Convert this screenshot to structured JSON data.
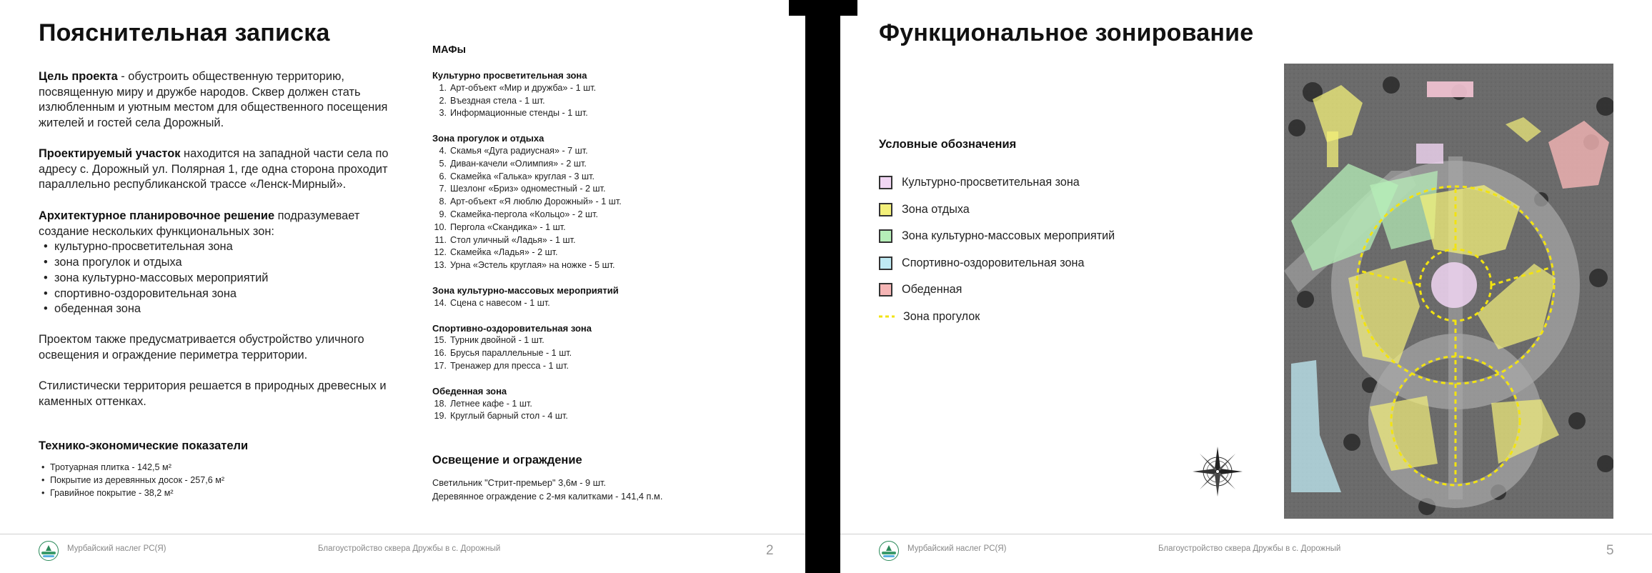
{
  "left_page": {
    "title": "Пояснительная записка",
    "goal": {
      "label": "Цель проекта",
      "text": " - обустроить общественную территорию, посвященную миру и дружбе народов. Сквер должен стать излюбленным и уютным местом для общественного посещения жителей и гостей села Дорожный."
    },
    "site": {
      "label": "Проектируемый участок",
      "text": " находится на западной части села по адресу с. Дорожный ул. Полярная 1, где одна сторона проходит параллельно республиканской трассе «Ленск-Мирный»."
    },
    "arch": {
      "label": "Архитектурное планировочное решение",
      "text": " подразумевает создание нескольких функциональных зон:",
      "zones": [
        "культурно-просветительная зона",
        "зона прогулок и отдыха",
        "зона культурно-массовых мероприятий",
        "спортивно-оздоровительная зона",
        "обеденная зона"
      ]
    },
    "lighting_text": "Проектом также предусматривается обустройство уличного освещения и ограждение периметра территории.",
    "style_text": "Стилистически территория решается в природных древесных и каменных оттенках.",
    "tep": {
      "title": "Технико-экономические показатели",
      "items": [
        "Тротуарная плитка - 142,5 м²",
        "Покрытие из деревянных досок - 257,6 м²",
        "Гравийное покрытие - 38,2 м²"
      ]
    },
    "mafs": {
      "title": "МАФы",
      "groups": [
        {
          "title": "Культурно просветительная зона",
          "items": [
            {
              "n": "1.",
              "t": "Арт-объект «Мир и дружба» - 1 шт."
            },
            {
              "n": "2.",
              "t": "Въездная стела - 1 шт."
            },
            {
              "n": "3.",
              "t": "Информационные стенды - 1 шт."
            }
          ]
        },
        {
          "title": "Зона прогулок и отдыха",
          "items": [
            {
              "n": "4.",
              "t": "Скамья «Дуга радиусная» - 7 шт."
            },
            {
              "n": "5.",
              "t": "Диван-качели «Олимпия» - 2 шт."
            },
            {
              "n": "6.",
              "t": "Скамейка «Галька» круглая - 3 шт."
            },
            {
              "n": "7.",
              "t": "Шезлонг «Бриз» одноместный - 2 шт."
            },
            {
              "n": "8.",
              "t": "Арт-объект «Я люблю Дорожный» - 1 шт."
            },
            {
              "n": "9.",
              "t": "Скамейка-пергола «Кольцо» - 2 шт."
            },
            {
              "n": "10.",
              "t": "Пергола «Скандика» - 1 шт."
            },
            {
              "n": "11.",
              "t": "Стол уличный «Ладья» - 1 шт."
            },
            {
              "n": "12.",
              "t": "Скамейка «Ладья» - 2 шт."
            },
            {
              "n": "13.",
              "t": "Урна «Эстель круглая» на ножке - 5 шт."
            }
          ]
        },
        {
          "title": "Зона культурно-массовых мероприятий",
          "items": [
            {
              "n": "14.",
              "t": "Сцена с навесом - 1 шт."
            }
          ]
        },
        {
          "title": "Спортивно-оздоровительная зона",
          "items": [
            {
              "n": "15.",
              "t": "Турник двойной - 1 шт."
            },
            {
              "n": "16.",
              "t": "Брусья параллельные - 1 шт."
            },
            {
              "n": "17.",
              "t": "Тренажер для пресса - 1 шт."
            }
          ]
        },
        {
          "title": "Обеденная зона",
          "items": [
            {
              "n": "18.",
              "t": "Летнее кафе - 1 шт."
            },
            {
              "n": "19.",
              "t": "Круглый барный стол - 4 шт."
            }
          ]
        }
      ]
    },
    "light_fence": {
      "title": "Освещение и ограждение",
      "lines": [
        "Светильник \"Стрит-премьер\" 3,6м - 9 шт.",
        "Деревянное ограждение с 2-мя калитками - 141,4 п.м."
      ]
    },
    "footer": {
      "org": "Мурбайский наслег РС(Я)",
      "project": "Благоустройство сквера Дружбы в с. Дорожный",
      "page": "2"
    }
  },
  "right_page": {
    "title": "Функциональное зонирование",
    "legend_title": "Условные обозначения",
    "legend": [
      {
        "label": "Культурно-просветительная зона",
        "color": "#f1d6f3"
      },
      {
        "label": "Зона отдыха",
        "color": "#f3f07a"
      },
      {
        "label": "Зона культурно-массовых мероприятий",
        "color": "#b6efb8"
      },
      {
        "label": "Спортивно-оздоровительная зона",
        "color": "#bfeaf3"
      },
      {
        "label": "Обеденная",
        "color": "#f5b5b5"
      },
      {
        "label": "Зона прогулок",
        "color": "#f2e311",
        "style": "dashed"
      }
    ],
    "footer": {
      "org": "Мурбайский наслег РС(Я)",
      "project": "Благоустройство сквера Дружбы в с. Дорожный",
      "page": "5"
    }
  }
}
